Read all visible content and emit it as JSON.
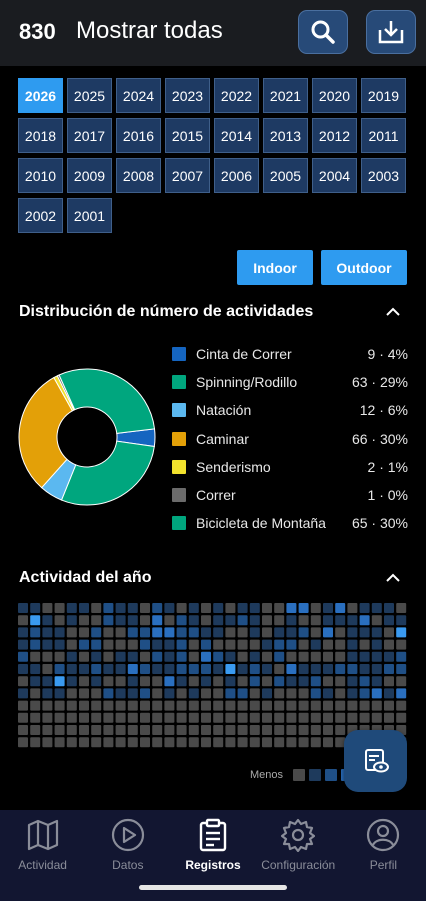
{
  "header": {
    "count": "830",
    "title": "Mostrar todas",
    "search_icon": "search-icon",
    "download_icon": "download-icon"
  },
  "years": [
    "2026",
    "2025",
    "2024",
    "2023",
    "2022",
    "2021",
    "2020",
    "2019",
    "2018",
    "2017",
    "2016",
    "2015",
    "2014",
    "2013",
    "2012",
    "2011",
    "2010",
    "2009",
    "2008",
    "2007",
    "2006",
    "2005",
    "2004",
    "2003",
    "2002",
    "2001"
  ],
  "selected_year": "2026",
  "filters": {
    "indoor": "Indoor",
    "outdoor": "Outdoor"
  },
  "distribution": {
    "title": "Distribución de número de actividades",
    "items": [
      {
        "label": "Cinta de Correr",
        "value": "9 · 4%",
        "count": 9,
        "color": "#1565c0"
      },
      {
        "label": "Spinning/Rodillo",
        "value": "63 · 29%",
        "count": 63,
        "color": "#00a67e"
      },
      {
        "label": "Natación",
        "value": "12 · 6%",
        "count": 12,
        "color": "#5bb8f0"
      },
      {
        "label": "Caminar",
        "value": "66 · 30%",
        "count": 66,
        "color": "#e3a008"
      },
      {
        "label": "Senderismo",
        "value": "2 · 1%",
        "count": 2,
        "color": "#f2e22d"
      },
      {
        "label": "Correr",
        "value": "1 · 0%",
        "count": 1,
        "color": "#6b6b6b"
      },
      {
        "label": "Bicicleta de Montaña",
        "value": "65 · 30%",
        "count": 65,
        "color": "#00a67e"
      }
    ]
  },
  "year_activity": {
    "title": "Actividad del año",
    "legend_less": "Menos",
    "colors": [
      "#4a4a4a",
      "#1e3a5c",
      "#1f4f86",
      "#2a6fbf",
      "#3a9af0"
    ]
  },
  "nav": [
    {
      "label": "Actividad",
      "icon": "map-icon"
    },
    {
      "label": "Datos",
      "icon": "play-icon"
    },
    {
      "label": "Registros",
      "icon": "clipboard-icon",
      "active": true
    },
    {
      "label": "Configuración",
      "icon": "gear-icon"
    },
    {
      "label": "Perfil",
      "icon": "user-icon"
    }
  ]
}
